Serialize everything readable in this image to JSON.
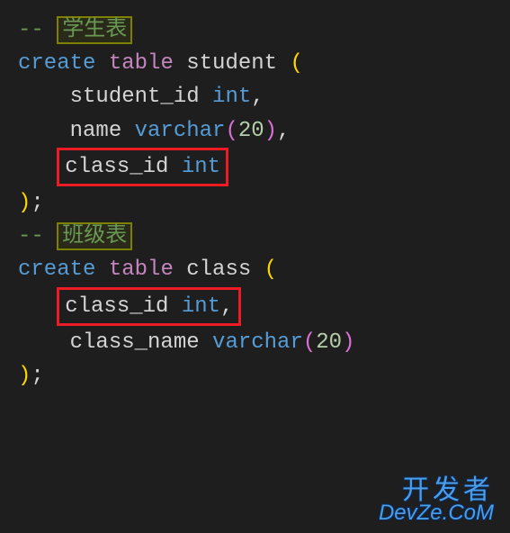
{
  "code": {
    "comment1_prefix": "-- ",
    "comment1_text": "学生表",
    "create": "create ",
    "table": "table",
    "student_name": " student ",
    "open_paren": "(",
    "close_paren": ")",
    "semicolon": ";",
    "student_id": "    student_id ",
    "int": "int",
    "comma": ",",
    "name_field": "    name ",
    "varchar": "varchar",
    "twenty": "20",
    "class_id": "class_id ",
    "class_id_indented": "    class_id ",
    "comment2_prefix": "-- ",
    "comment2_text": "班级表",
    "class_table": " class ",
    "class_name_field": "    class_name ",
    "int_space": "int"
  },
  "watermark": {
    "line1": "开发者",
    "line2": "DevZe.CoM"
  }
}
